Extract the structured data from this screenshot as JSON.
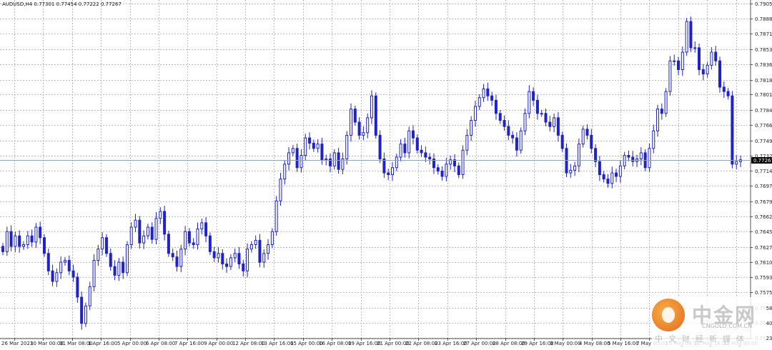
{
  "chart_data": {
    "type": "candlestick",
    "symbol_info": "AUDUSD,H4  0.77301 0.77454 0.77222 0.77267",
    "current_price": "0.77267",
    "ylim": [
      0.75235,
      0.79055
    ],
    "y_ticks": [
      "0.79055",
      "0.78880",
      "0.78710",
      "0.78535",
      "0.78360",
      "0.78185",
      "0.78015",
      "0.77840",
      "0.77665",
      "0.77490",
      "0.77320",
      "0.77145",
      "0.76970",
      "0.76795",
      "0.76625",
      "0.76450",
      "0.76275",
      "0.76100",
      "0.75930",
      "0.75755",
      "0.75580",
      "0.75405",
      "0.75235"
    ],
    "x_ticks": [
      "26 Mar 2021",
      "30 Mar 00:00",
      "31 Mar 08:00",
      "1 Apr 16:00",
      "5 Apr 00:00",
      "6 Apr 08:00",
      "7 Apr 16:00",
      "9 Apr 00:00",
      "12 Apr 08:00",
      "13 Apr 16:00",
      "15 Apr 00:00",
      "16 Apr 08:00",
      "19 Apr 16:00",
      "21 Apr 00:00",
      "22 Apr 08:00",
      "23 Apr 16:00",
      "27 Apr 00:00",
      "28 Apr 08:00",
      "29 Apr 16:00",
      "3 May 00:00",
      "4 May 08:00",
      "5 May 16:00",
      "7 May 00:00",
      "10 May 08:00",
      "11 May 16:00",
      "13 May 00:00"
    ],
    "closes": [
      0.7622,
      0.7645,
      0.7628,
      0.764,
      0.7628,
      0.763,
      0.764,
      0.7633,
      0.765,
      0.7638,
      0.762,
      0.76,
      0.7588,
      0.7598,
      0.761,
      0.7612,
      0.76,
      0.7593,
      0.757,
      0.754,
      0.756,
      0.7582,
      0.7612,
      0.7625,
      0.7638,
      0.762,
      0.7605,
      0.7595,
      0.761,
      0.7598,
      0.763,
      0.765,
      0.7658,
      0.7632,
      0.764,
      0.765,
      0.7636,
      0.766,
      0.7668,
      0.7642,
      0.762,
      0.7616,
      0.7605,
      0.7625,
      0.7645,
      0.7632,
      0.763,
      0.7648,
      0.7655,
      0.764,
      0.7622,
      0.7615,
      0.762,
      0.7608,
      0.7605,
      0.7615,
      0.762,
      0.7608,
      0.76,
      0.7625,
      0.763,
      0.7635,
      0.761,
      0.762,
      0.763,
      0.7645,
      0.768,
      0.7705,
      0.7722,
      0.7735,
      0.774,
      0.7718,
      0.7732,
      0.7752,
      0.7746,
      0.774,
      0.7745,
      0.7727,
      0.7728,
      0.772,
      0.7735,
      0.7716,
      0.7728,
      0.7755,
      0.7785,
      0.777,
      0.7755,
      0.7758,
      0.7775,
      0.78,
      0.7755,
      0.7728,
      0.7712,
      0.771,
      0.7718,
      0.773,
      0.7745,
      0.7735,
      0.776,
      0.7752,
      0.7738,
      0.7735,
      0.773,
      0.7728,
      0.7718,
      0.7714,
      0.7708,
      0.7722,
      0.7727,
      0.772,
      0.771,
      0.7738,
      0.7755,
      0.7772,
      0.7788,
      0.7798,
      0.7808,
      0.78,
      0.7795,
      0.778,
      0.7772,
      0.7765,
      0.7755,
      0.7752,
      0.7738,
      0.776,
      0.778,
      0.7805,
      0.7795,
      0.778,
      0.778,
      0.777,
      0.7765,
      0.7775,
      0.7755,
      0.774,
      0.7712,
      0.7715,
      0.772,
      0.7745,
      0.7762,
      0.7755,
      0.774,
      0.7725,
      0.771,
      0.7705,
      0.77,
      0.7712,
      0.7708,
      0.772,
      0.7732,
      0.773,
      0.7725,
      0.7728,
      0.7735,
      0.7718,
      0.774,
      0.776,
      0.7785,
      0.778,
      0.7805,
      0.784,
      0.784,
      0.783,
      0.785,
      0.7885,
      0.7855,
      0.7855,
      0.783,
      0.7825,
      0.7835,
      0.785,
      0.784,
      0.781,
      0.7805,
      0.78,
      0.7722,
      0.7725,
      0.7727
    ]
  },
  "watermark": {
    "name": "中金网",
    "url": "CNGOLD.COM.CN",
    "slogan": "中文财经新媒体"
  }
}
